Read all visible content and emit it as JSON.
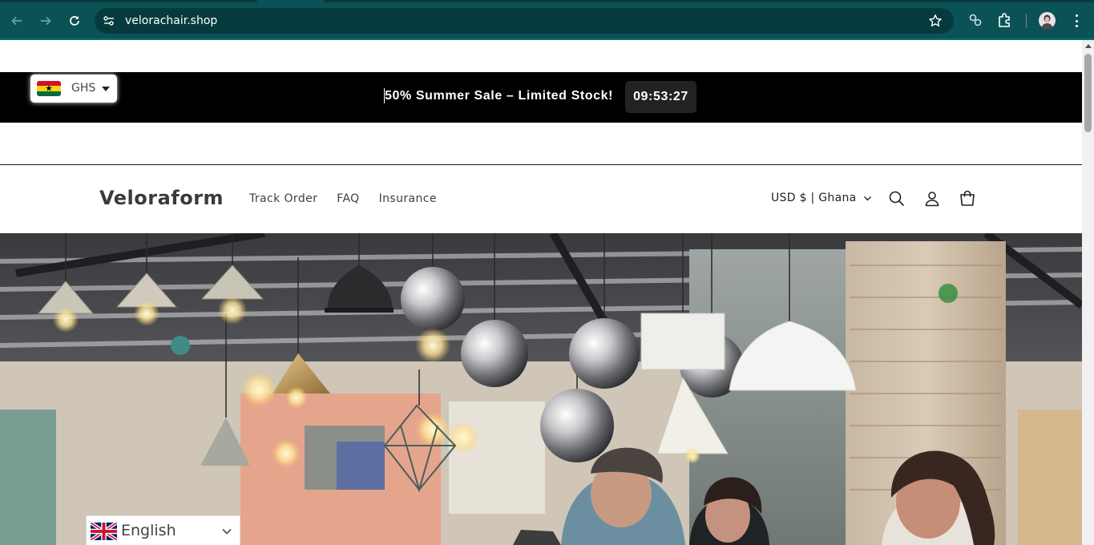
{
  "browser": {
    "url": "velorachair.shop",
    "back_icon": "arrow-left-icon",
    "forward_icon": "arrow-right-icon",
    "reload_icon": "reload-icon",
    "site_info_icon": "tune-icon",
    "bookmark_icon": "star-icon",
    "extensions": [
      "link-extension-icon",
      "puzzle-extension-icon"
    ],
    "menu_icon": "kebab-menu-icon"
  },
  "announcement": {
    "message": "50% Summer Sale – Limited Stock!",
    "countdown": "09:53:27",
    "background": "#000000"
  },
  "currency_switcher": {
    "flag": "ghana-flag",
    "code": "GHS"
  },
  "header": {
    "brand": "Veloraform",
    "nav": [
      {
        "label": "Track Order"
      },
      {
        "label": "FAQ"
      },
      {
        "label": "Insurance"
      }
    ],
    "locale": "USD $ | Ghana",
    "icons": [
      "search-icon",
      "account-icon",
      "cart-icon"
    ]
  },
  "language_selector": {
    "flag": "uk-flag",
    "label": "English"
  },
  "hero": {
    "image": "lighting-showroom-with-pendant-lamps-and-people"
  },
  "colors": {
    "chrome": "#0b5257",
    "omnibox": "#053b3f",
    "brand_text": "#3a3a3a",
    "timer_bg": "#222222"
  }
}
